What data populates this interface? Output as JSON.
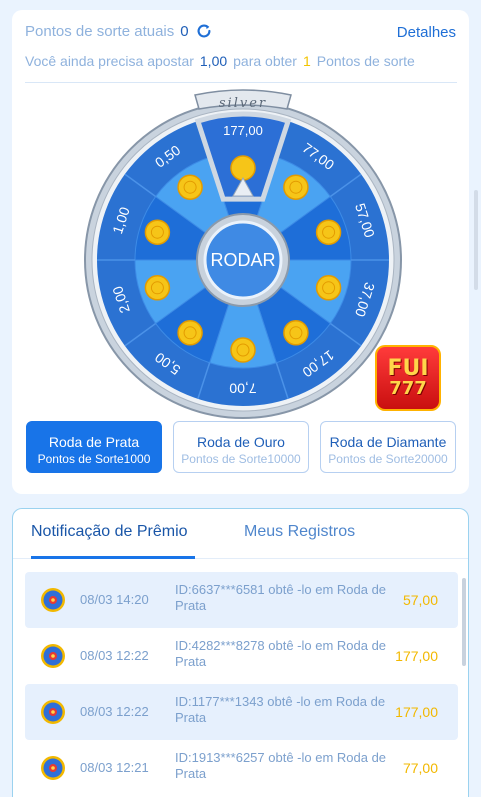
{
  "header": {
    "points_label": "Pontos de sorte atuais",
    "points_value": "0",
    "details_link": "Detalhes",
    "need_prefix": "Você ainda precisa apostar",
    "need_amount": "1,00",
    "need_middle": "para obter",
    "need_points": "1",
    "need_suffix": "Pontos de sorte"
  },
  "wheel": {
    "badge": "silver",
    "pointer_value": "177,00",
    "center_button": "RODAR",
    "segments": [
      "177,00",
      "77,00",
      "57,00",
      "37,00",
      "17,00",
      "7,00",
      "5,00",
      "2,00",
      "1,00",
      "0,50"
    ],
    "colors": {
      "dark": "#1e6ed8",
      "light": "#4aa3f2",
      "rim": "#2b72d2",
      "gold": "#f6c518"
    }
  },
  "logo": {
    "line1": "FUI",
    "line2": "777"
  },
  "wheel_tabs": [
    {
      "title": "Roda de Prata",
      "subtitle": "Pontos de Sorte1000",
      "active": true
    },
    {
      "title": "Roda de Ouro",
      "subtitle": "Pontos de Sorte10000",
      "active": false
    },
    {
      "title": "Roda de Diamante",
      "subtitle": "Pontos de Sorte20000",
      "active": false
    }
  ],
  "records": {
    "tabs": [
      "Notificação de Prêmio",
      "Meus Registros"
    ],
    "rows": [
      {
        "date": "08/03 14:20",
        "desc": "ID:6637***6581 obtê -lo em Roda de Prata",
        "amount": "57,00"
      },
      {
        "date": "08/03 12:22",
        "desc": "ID:4282***8278 obtê -lo em Roda de Prata",
        "amount": "177,00"
      },
      {
        "date": "08/03 12:22",
        "desc": "ID:1177***1343 obtê -lo em Roda de Prata",
        "amount": "177,00"
      },
      {
        "date": "08/03 12:21",
        "desc": "ID:1913***6257 obtê -lo em Roda de Prata",
        "amount": "77,00"
      }
    ]
  }
}
